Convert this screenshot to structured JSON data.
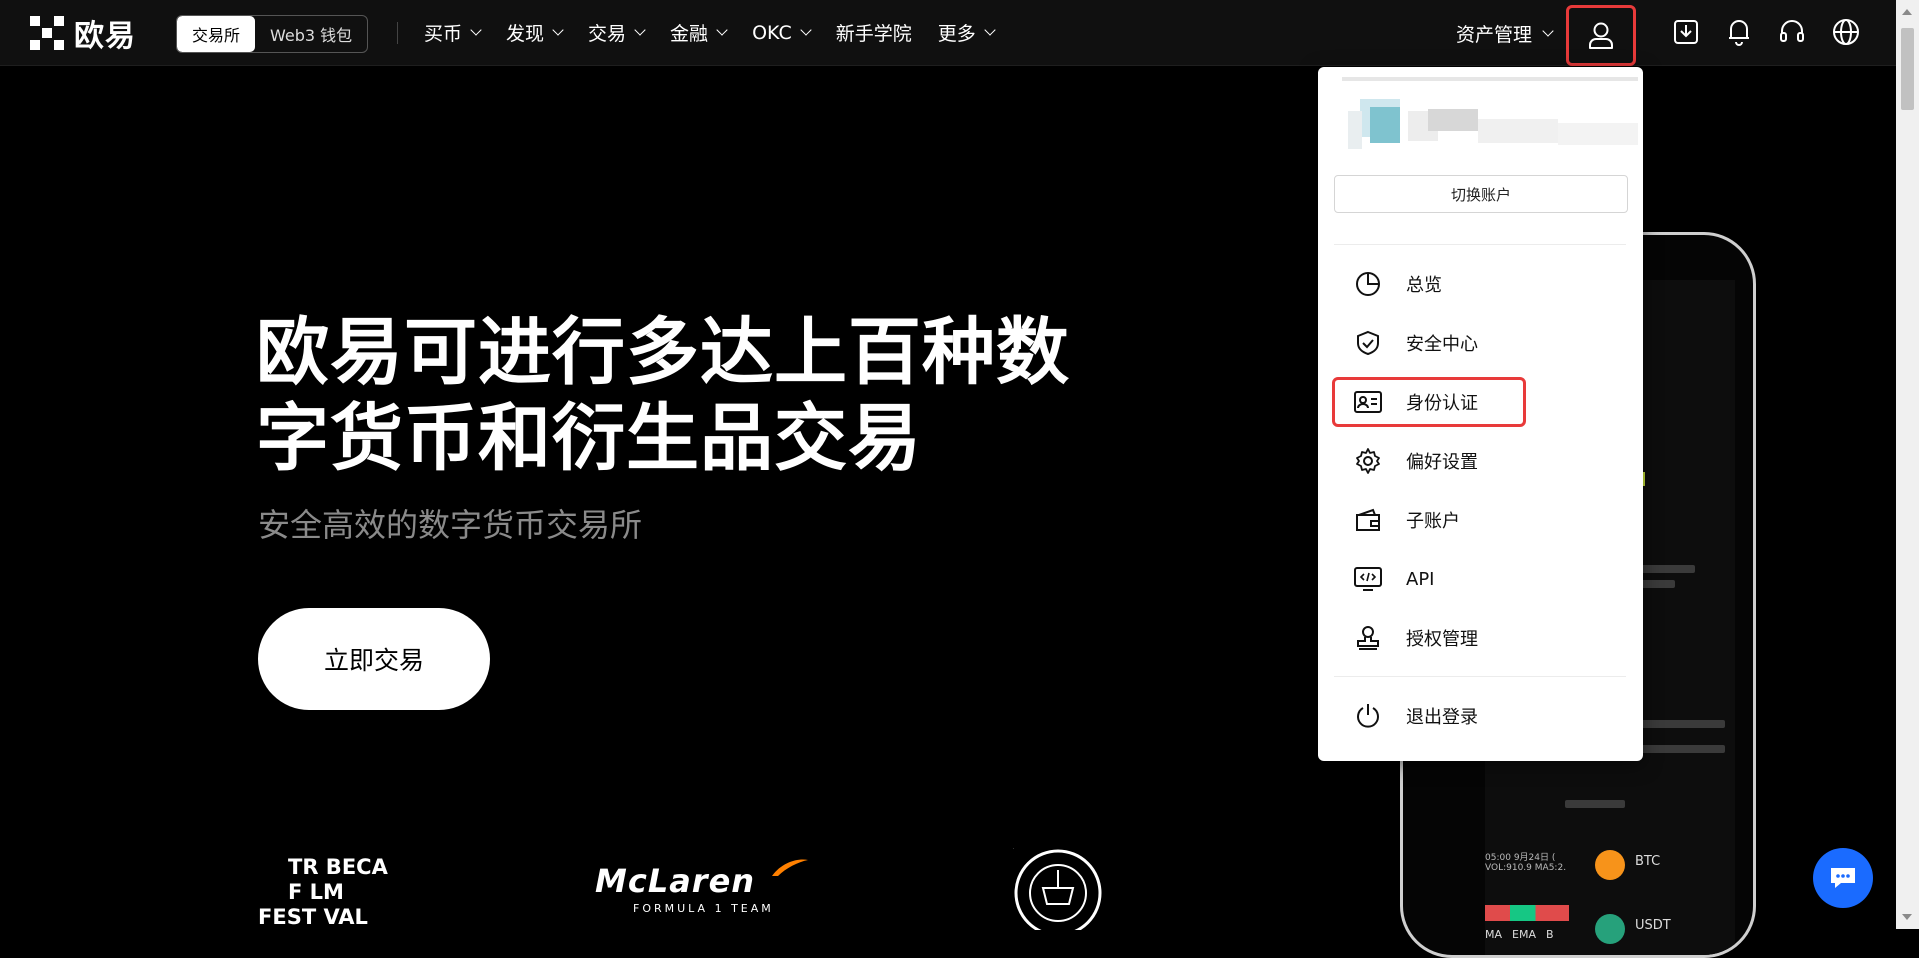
{
  "topbar": {
    "logo_text": "欧易",
    "mode_tabs": [
      "交易所",
      "Web3 钱包"
    ],
    "nav": [
      {
        "label": "买币",
        "dropdown": true
      },
      {
        "label": "发现",
        "dropdown": true
      },
      {
        "label": "交易",
        "dropdown": true
      },
      {
        "label": "金融",
        "dropdown": true
      },
      {
        "label": "OKC",
        "dropdown": true
      },
      {
        "label": "新手学院",
        "dropdown": false
      },
      {
        "label": "更多",
        "dropdown": true
      }
    ],
    "asset_label": "资产管理"
  },
  "hero": {
    "title_line1": "欧易可进行多达上百种数",
    "title_line2": "字货币和衍生品交易",
    "subtitle": "安全高效的数字货币交易所",
    "cta": "立即交易"
  },
  "partners": {
    "tribeca_line1": "TR BECA",
    "tribeca_line2": "F LM",
    "tribeca_line3": "FEST VAL",
    "mclaren": "McLaren",
    "mclaren_sub": "FORMULA 1 TEAM",
    "mancity": "MANCHESTER CITY"
  },
  "phone": {
    "time": "05:00",
    "date": "9月24日 (",
    "vol": "VOL:910.9",
    "ma": "MA5:2.",
    "tabs": [
      "MA",
      "EMA",
      "B"
    ],
    "coin1": "BTC",
    "coin2": "USDT"
  },
  "dropdown": {
    "switch_account": "切换账户",
    "items": [
      {
        "label": "总览",
        "icon": "pie-chart-icon"
      },
      {
        "label": "安全中心",
        "icon": "shield-check-icon"
      },
      {
        "label": "身份认证",
        "icon": "id-card-icon"
      },
      {
        "label": "偏好设置",
        "icon": "gear-icon"
      },
      {
        "label": "子账户",
        "icon": "wallet-icon"
      },
      {
        "label": "API",
        "icon": "code-monitor-icon"
      },
      {
        "label": "授权管理",
        "icon": "stamp-icon"
      }
    ],
    "logout": "退出登录"
  },
  "colors": {
    "accent_red": "#e83a3a",
    "chat_blue": "#1a6bff"
  }
}
